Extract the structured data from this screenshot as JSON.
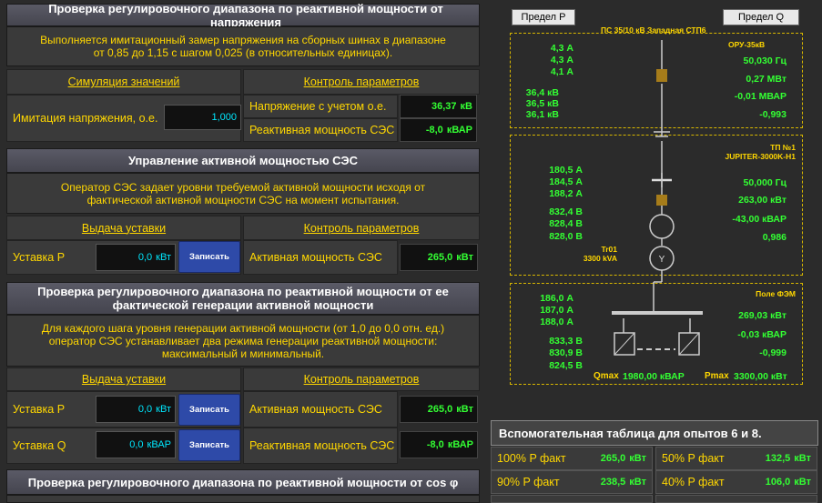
{
  "p1": {
    "title": "Проверка регулировочного диапазона по реактивной мощности от напряжения",
    "desc": "Выполняется имитационный замер напряжения на сборных шинах в диапазоне от 0,85 до 1,15 с шагом 0,025 (в относительных единицах).",
    "sim_link": "Симуляция значений",
    "ctrl_link": "Контроль параметров",
    "input_label": "Имитация напряжения, о.е.",
    "input_value": "1,000",
    "row1_label": "Напряжение с учетом о.е.",
    "row1_value": "36,37",
    "row1_unit": "кВ",
    "row2_label": "Реактивная мощность СЭС",
    "row2_value": "-8,0",
    "row2_unit": "кВАР"
  },
  "p2": {
    "title": "Управление активной мощностью СЭС",
    "desc": "Оператор СЭС задает уровни требуемой активной мощности исходя от фактической активной мощности СЭС на момент испытания.",
    "out_link": "Выдача уставки",
    "ctrl_link": "Контроль параметров",
    "set_label": "Уставка P",
    "set_value": "0,0",
    "set_unit": "кВт",
    "btn": "Записать",
    "row_label": "Активная мощность СЭС",
    "row_value": "265,0",
    "row_unit": "кВт"
  },
  "p3": {
    "title": "Проверка регулировочного диапазона по реактивной мощности от ее фактической генерации активной мощности",
    "desc": "Для каждого шага уровня генерации активной мощности (от 1,0 до 0,0 отн. ед.) оператор СЭС устанавливает два режима генерации реактивной мощности: максимальный и минимальный.",
    "out_link": "Выдача уставки",
    "ctrl_link": "Контроль параметров",
    "setP_label": "Уставка P",
    "setP_value": "0,0",
    "setP_unit": "кВт",
    "setQ_label": "Уставка Q",
    "setQ_value": "0,0",
    "setQ_unit": "кВАР",
    "btn": "Записать",
    "row1_label": "Активная мощность СЭС",
    "row1_value": "265,0",
    "row1_unit": "кВт",
    "row2_label": "Реактивная мощность СЭС",
    "row2_value": "-8,0",
    "row2_unit": "кВАР"
  },
  "p4": {
    "title": "Проверка регулировочного диапазона по реактивной мощности от cos φ"
  },
  "diagram": {
    "limit_p": "Предел P",
    "limit_q": "Предел Q",
    "sub_title": "ПС 35/10 кВ Западная СТП6",
    "oru": "ОРУ-35кВ",
    "box1_left": [
      "4,3 А",
      "4,3 А",
      "4,1 А",
      "36,4 кВ",
      "36,5 кВ",
      "36,1 кВ"
    ],
    "box1_right": [
      "50,030 Гц",
      "0,27 МВт",
      "-0,01 МВАР",
      "-0,993"
    ],
    "tp": "ТП №1",
    "tp_model": "JUPITER-3000K-H1",
    "box2_left": [
      "180,5 А",
      "184,5 А",
      "188,2 А",
      "832,4 В",
      "828,4 В",
      "828,0 В"
    ],
    "box2_right": [
      "50,000 Гц",
      "263,00 кВт",
      "-43,00 кВАР",
      "0,986"
    ],
    "tr": "Tr01",
    "tr_power": "3300 kVA",
    "fem": "Поле ФЭМ",
    "box3_left": [
      "186,0 А",
      "187,0 А",
      "188,0 А",
      "833,3 В",
      "830,9 В",
      "824,5 В"
    ],
    "box3_right": [
      "269,03 кВт",
      "-0,03 кВАР",
      "-0,999"
    ],
    "qmax_label": "Qmax",
    "qmax_value": "1980,00 кВАР",
    "pmax_label": "Pmax",
    "pmax_value": "3300,00 кВт"
  },
  "aux": {
    "title": "Вспомогательная таблица для опытов 6 и 8.",
    "rows": [
      {
        "l1": "100% P факт",
        "v1": "265,0",
        "l2": "50% P факт",
        "v2": "132,5"
      },
      {
        "l1": "90% P факт",
        "v1": "238,5",
        "l2": "40% P факт",
        "v2": "106,0"
      }
    ],
    "unit": "кВт"
  },
  "colors": {
    "accent_green": "#33ff33",
    "accent_yellow": "#ffd700",
    "value_cyan": "#00e8ff",
    "button_blue": "#2e4aa8"
  }
}
